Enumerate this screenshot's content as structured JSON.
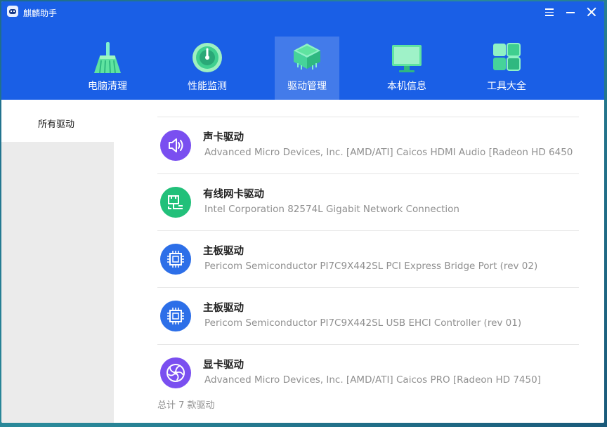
{
  "window": {
    "title": "麒麟助手"
  },
  "nav": {
    "tabs": [
      {
        "label": "电脑清理",
        "icon": "broom-icon"
      },
      {
        "label": "性能监测",
        "icon": "gauge-icon"
      },
      {
        "label": "驱动管理",
        "icon": "chip-stack-icon",
        "active": true
      },
      {
        "label": "本机信息",
        "icon": "monitor-icon"
      },
      {
        "label": "工具大全",
        "icon": "grid-tools-icon"
      }
    ]
  },
  "sidebar": {
    "items": [
      {
        "label": "所有驱动",
        "selected": true
      }
    ]
  },
  "drivers": [
    {
      "name": "声卡驱动",
      "desc": "Advanced Micro Devices, Inc. [AMD/ATI] Caicos HDMI Audio [Radeon HD 6450",
      "icon": "speaker-icon",
      "color": "#7a4ff0"
    },
    {
      "name": "有线网卡驱动",
      "desc": "Intel Corporation 82574L Gigabit Network Connection",
      "icon": "network-icon",
      "color": "#22c07a"
    },
    {
      "name": "主板驱动",
      "desc": "Pericom Semiconductor PI7C9X442SL PCI Express Bridge Port (rev 02)",
      "icon": "chip-icon",
      "color": "#2d6fe8"
    },
    {
      "name": "主板驱动",
      "desc": "Pericom Semiconductor PI7C9X442SL USB EHCI Controller (rev 01)",
      "icon": "chip-icon",
      "color": "#2d6fe8"
    },
    {
      "name": "显卡驱动",
      "desc": "Advanced Micro Devices, Inc. [AMD/ATI] Caicos PRO [Radeon HD 7450]",
      "icon": "fan-icon",
      "color": "#7a4ff0"
    }
  ],
  "footer": {
    "total": "总计 7 款驱动"
  },
  "colors": {
    "header": "#1a5fe6",
    "accent": "#2d6fe8"
  }
}
